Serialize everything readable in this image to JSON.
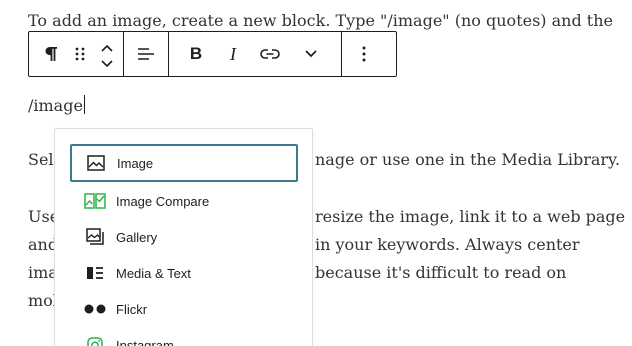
{
  "content": {
    "line1": "To add an image, create a new block. Type \"/image\" (no quotes) and the",
    "slash_command": "/image",
    "para2_left": "Sele",
    "para2_right": "nage or use one in the Media Library.",
    "para3_line1_left": "Use",
    "para3_line1_right": "resize the image, link it to a web page",
    "para3_line2_left": "and",
    "para3_line2_right": "in your keywords. Always center",
    "para3_line3_left": "ima",
    "para3_line3_right": "because it's difficult to read on",
    "para3_line4_left": "mol"
  },
  "toolbar": {
    "paragraph_icon": "paragraph-icon",
    "drag_icon": "drag-handle-icon",
    "move_up_icon": "chevron-up-icon",
    "move_down_icon": "chevron-down-icon",
    "align_icon": "align-left-icon",
    "bold_label": "B",
    "italic_label": "I",
    "link_icon": "link-icon",
    "more_rich_text_icon": "chevron-down-icon",
    "options_icon": "more-vertical-icon"
  },
  "inserter": {
    "items": [
      {
        "label": "Image",
        "icon": "image-icon",
        "icon_color": "#1e1e1e"
      },
      {
        "label": "Image Compare",
        "icon": "image-compare-icon",
        "icon_color": "#2bb34a"
      },
      {
        "label": "Gallery",
        "icon": "gallery-icon",
        "icon_color": "#1e1e1e"
      },
      {
        "label": "Media & Text",
        "icon": "media-text-icon",
        "icon_color": "#1e1e1e"
      },
      {
        "label": "Flickr",
        "icon": "flickr-icon",
        "icon_color": "#1e1e1e"
      },
      {
        "label": "Instagram",
        "icon": "instagram-icon",
        "icon_color": "#2bb34a"
      }
    ],
    "selected_index": 0,
    "accent": "#3d7a8f"
  }
}
